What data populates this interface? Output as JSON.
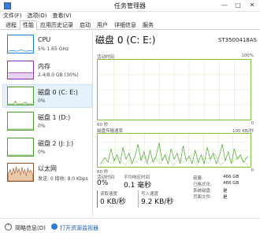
{
  "window": {
    "title": "任务管理器",
    "min": "—",
    "max": "□",
    "close": "✕"
  },
  "menu": [
    "文件(F)",
    "选项(O)",
    "查看(V)"
  ],
  "tabs": [
    "进程",
    "性能",
    "应用历史记录",
    "启动",
    "用户",
    "详细信息",
    "服务"
  ],
  "active_tab": 1,
  "sidebar": [
    {
      "name": "CPU",
      "sub": "5% 1.65 GHz",
      "color": "#1c7fd8",
      "selected": false
    },
    {
      "name": "内存",
      "sub": "2.4/8.0 GB (30%)",
      "color": "#8b2fbd",
      "selected": false
    },
    {
      "name": "磁盘 0 (C: E:)",
      "sub": "0%",
      "color": "#4a9f2a",
      "selected": true
    },
    {
      "name": "磁盘 1 (D:)",
      "sub": "0%",
      "color": "#4a9f2a",
      "selected": false
    },
    {
      "name": "磁盘 2 (J: J:)",
      "sub": "0%",
      "color": "#4a9f2a",
      "selected": false
    },
    {
      "name": "以太网",
      "sub": "发送: 0 接收: 8.0 Kbps",
      "color": "#a0522d",
      "selected": false
    }
  ],
  "main": {
    "title": "磁盘 0 (C: E:)",
    "model": "ST3500418AS",
    "graph1": {
      "top_left": "活动时间",
      "top_right": "100%",
      "bottom_left": "60 秒",
      "bottom_right": "0"
    },
    "graph2": {
      "top_left": "磁盘传输速率",
      "top_right": "100 KB/秒",
      "bottom_left": "60 秒",
      "bottom_right": "0"
    },
    "stats": {
      "active_label": "活动时间",
      "active_value": "0%",
      "resp_label": "平均响应时间",
      "resp_value": "0.1 毫秒",
      "read_label": "读取速度",
      "read_value": "0 KB/秒",
      "write_label": "写入速度",
      "write_value": "9.2 KB/秒"
    },
    "right_info": [
      {
        "label": "容量:",
        "value": "466 GB"
      },
      {
        "label": "已格式化:",
        "value": "466 GB"
      },
      {
        "label": "系统磁盘:",
        "value": "是"
      },
      {
        "label": "页面文件:",
        "value": "是"
      }
    ]
  },
  "footer": {
    "less": "简略信息(D)",
    "resmon": "打开资源监视器"
  },
  "colors": {
    "disk_green": "#4a9f2a",
    "grid": "#d8ecc8"
  }
}
